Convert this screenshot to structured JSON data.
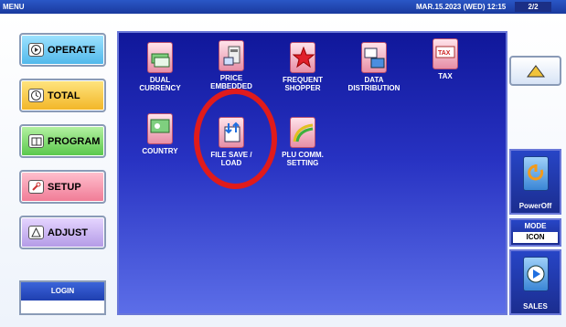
{
  "titlebar": {
    "menu": "MENU",
    "datetime": "MAR.15.2023 (WED) 12:15",
    "page": "2/2"
  },
  "left_menu": {
    "operate": "OPERATE",
    "total": "TOTAL",
    "program": "PROGRAM",
    "setup": "SETUP",
    "adjust": "ADJUST"
  },
  "login": {
    "label": "LOGIN",
    "value": ""
  },
  "tiles": [
    {
      "label": "DUAL\nCURRENCY",
      "icon": "dual-currency-icon"
    },
    {
      "label": "PRICE\nEMBEDDED",
      "icon": "price-embedded-icon"
    },
    {
      "label": "FREQUENT\nSHOPPER",
      "icon": "frequent-shopper-icon"
    },
    {
      "label": "DATA\nDISTRIBUTION",
      "icon": "data-distribution-icon"
    },
    {
      "label": "TAX",
      "icon": "tax-icon"
    },
    {
      "label": "COUNTRY",
      "icon": "country-icon"
    },
    {
      "label": "FILE SAVE /\nLOAD",
      "icon": "file-save-load-icon"
    },
    {
      "label": "PLU COMM.\nSETTING",
      "icon": "plu-comm-setting-icon"
    }
  ],
  "right": {
    "up": "▲",
    "power": "PowerOff",
    "mode_title": "MODE",
    "mode_value": "ICON",
    "sales": "SALES"
  },
  "colors": {
    "accent_red": "#e01b1b",
    "panel_blue": "#2732c2"
  }
}
